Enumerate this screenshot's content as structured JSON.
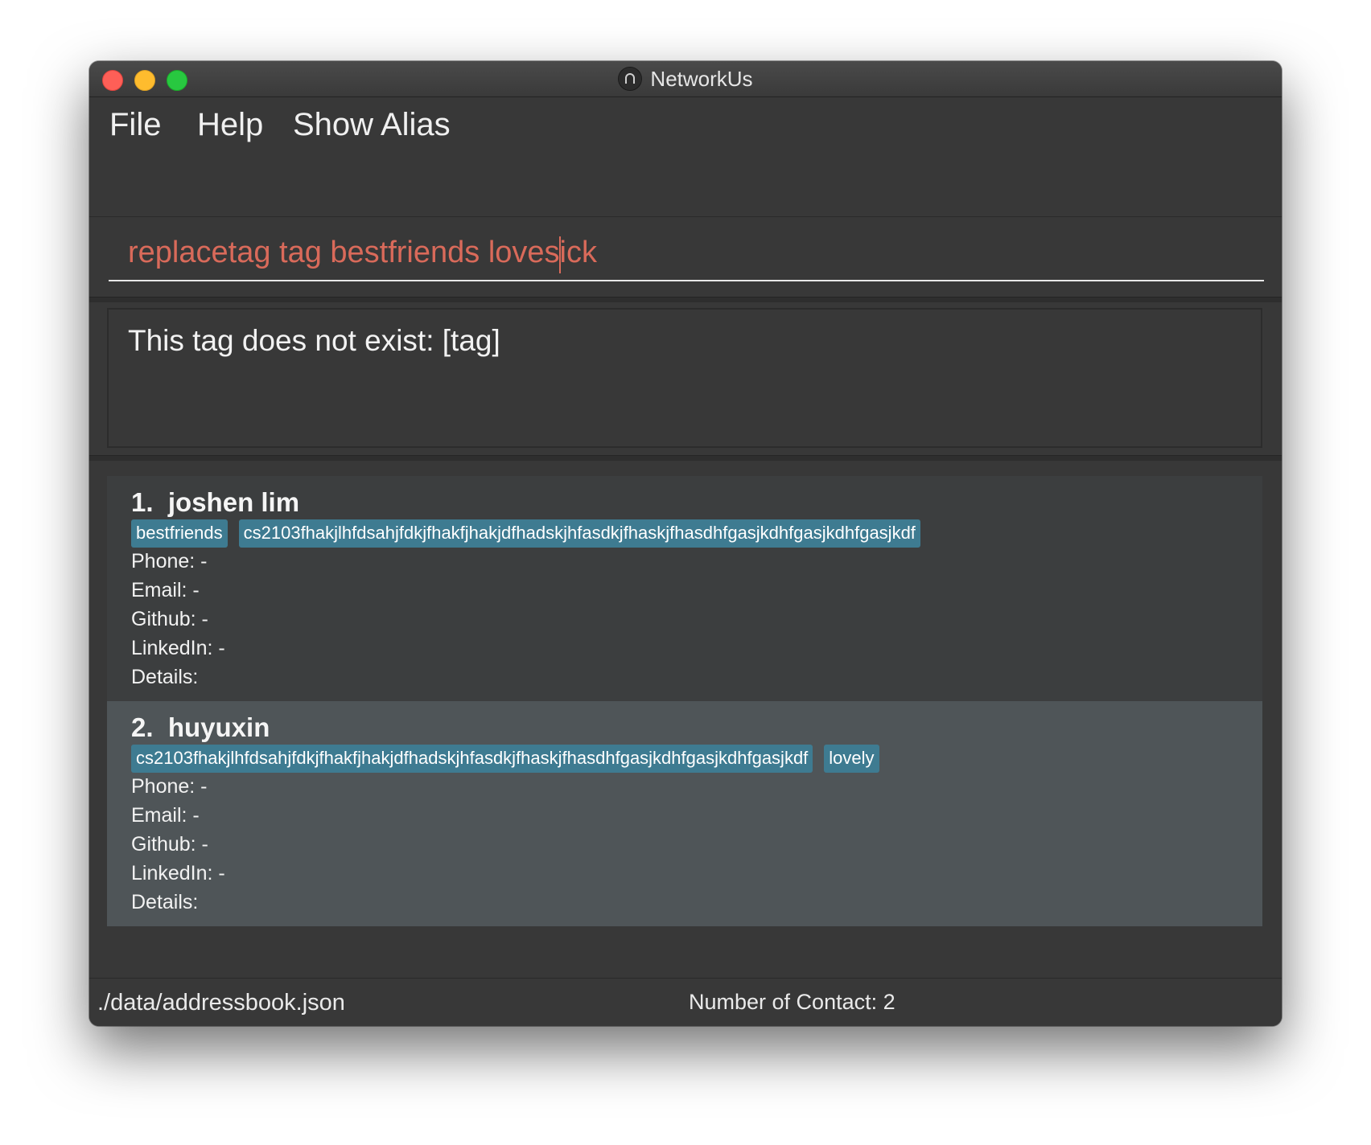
{
  "window": {
    "title": "NetworkUs",
    "app_icon": "app-logo-icon"
  },
  "menu": {
    "file": "File",
    "help": "Help",
    "show_alias": "Show Alias"
  },
  "command": {
    "value": "replacetag tag bestfriends lovesick",
    "text_color": "#d96a5a"
  },
  "result": {
    "message": "This tag does not exist: [tag]"
  },
  "contacts": [
    {
      "index": "1.",
      "name": "joshen lim",
      "tags": [
        "bestfriends",
        "cs2103fhakjlhfdsahjfdkjfhakfjhakjdfhadskjhfasdkjfhaskjfhasdhfgasjkdhfgasjkdhfgasjkdf"
      ],
      "phone": "Phone: -",
      "email": "Email: -",
      "github": "Github: -",
      "linkedin": "LinkedIn: -",
      "details": "Details:"
    },
    {
      "index": "2.",
      "name": "huyuxin",
      "tags": [
        "cs2103fhakjlhfdsahjfdkjfhakfjhakjdfhadskjhfasdkjfhaskjfhasdhfgasjkdhfgasjkdhfgasjkdf",
        "lovely"
      ],
      "phone": "Phone: -",
      "email": "Email: -",
      "github": "Github: -",
      "linkedin": "LinkedIn: -",
      "details": "Details:"
    }
  ],
  "status": {
    "file_path": "./data/addressbook.json",
    "contact_count": "Number of Contact: 2"
  },
  "colors": {
    "tag_background": "#3e7b91",
    "window_background": "#383838",
    "selected_card": "#4f5558"
  }
}
